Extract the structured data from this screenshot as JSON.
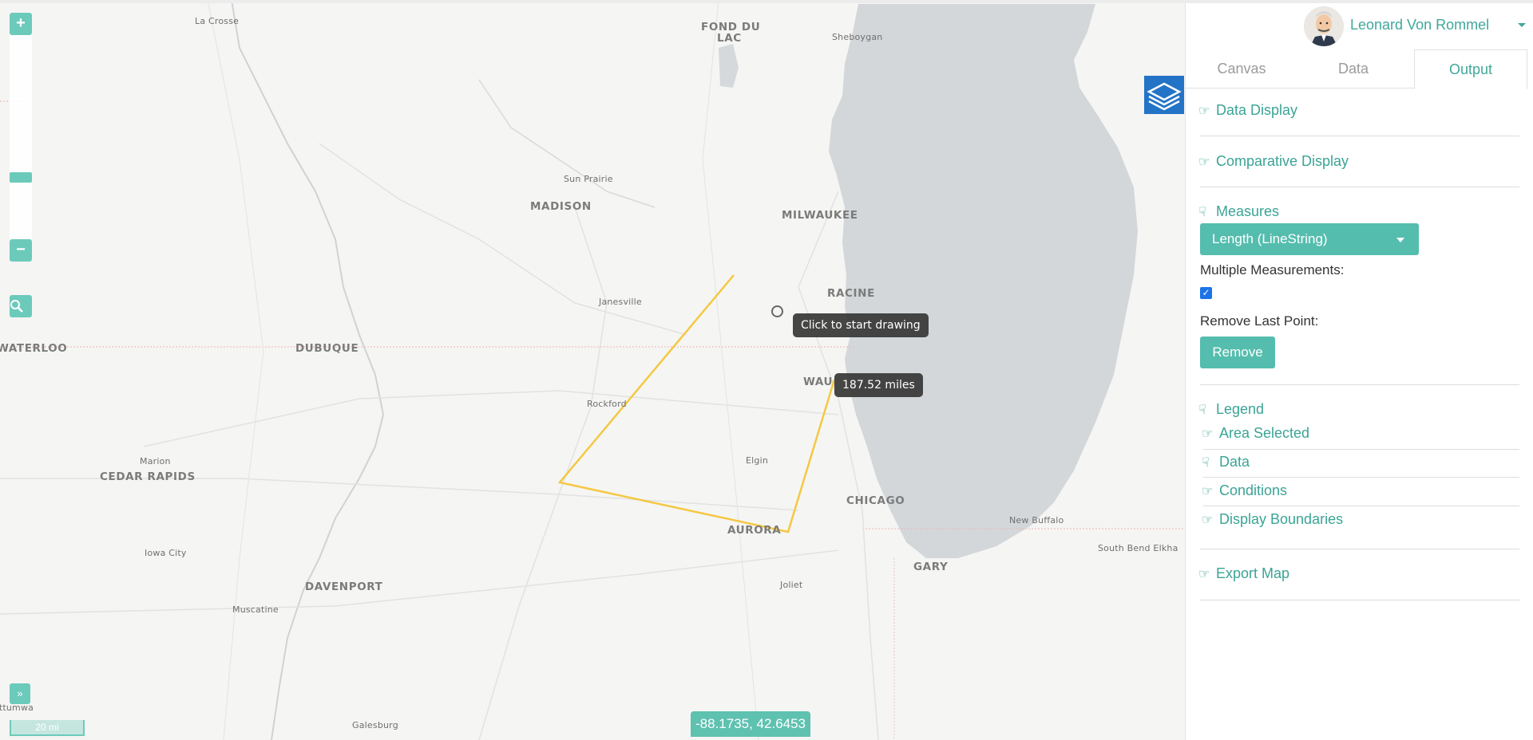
{
  "map": {
    "cities": [
      {
        "name": "La Crosse",
        "big": false
      },
      {
        "name": "FOND DU",
        "big": true
      },
      {
        "name": "LAC",
        "big": true
      },
      {
        "name": "Sheboygan",
        "big": false
      },
      {
        "name": "Sun Prairie",
        "big": false
      },
      {
        "name": "MADISON",
        "big": true
      },
      {
        "name": "MILWAUKEE",
        "big": true
      },
      {
        "name": "Janesville",
        "big": false
      },
      {
        "name": "RACINE",
        "big": true
      },
      {
        "name": "WATERLOO",
        "big": true
      },
      {
        "name": "DUBUQUE",
        "big": true
      },
      {
        "name": "WAU",
        "big": true
      },
      {
        "name": "Rockford",
        "big": false
      },
      {
        "name": "Marion",
        "big": false
      },
      {
        "name": "CEDAR RAPIDS",
        "big": true
      },
      {
        "name": "Elgin",
        "big": false
      },
      {
        "name": "CHICAGO",
        "big": true
      },
      {
        "name": "New Buffalo",
        "big": false
      },
      {
        "name": "AURORA",
        "big": true
      },
      {
        "name": "Iowa City",
        "big": false
      },
      {
        "name": "South Bend Elkha",
        "big": false
      },
      {
        "name": "GARY",
        "big": true
      },
      {
        "name": "DAVENPORT",
        "big": true
      },
      {
        "name": "Joliet",
        "big": false
      },
      {
        "name": "Muscatine",
        "big": false
      },
      {
        "name": "Galesburg",
        "big": false
      },
      {
        "name": "Ottumwa",
        "big": false
      }
    ],
    "tooltip_start": "Click to start drawing",
    "tooltip_measure": "187.52 miles",
    "coordinates": "-88.1735, 42.6453",
    "scale_label": "20 mi",
    "zoom_in": "+",
    "zoom_out": "−",
    "search_icon": "search-icon",
    "layers_icon": "layers-icon",
    "line_color": "#f5c842",
    "water_color": "#d3d7da"
  },
  "user": {
    "name": "Leonard Von Rommel"
  },
  "tabs": [
    {
      "label": "Canvas",
      "active": false
    },
    {
      "label": "Data",
      "active": false
    },
    {
      "label": "Output",
      "active": true
    }
  ],
  "panel": {
    "data_display": "Data Display",
    "comparative_display": "Comparative Display",
    "measures": "Measures",
    "measure_select": "Length (LineString)",
    "multiple_measurements": "Multiple Measurements:",
    "multiple_checked": true,
    "remove_last_point": "Remove Last Point:",
    "remove_button": "Remove",
    "legend": "Legend",
    "area_selected": "Area Selected",
    "data": "Data",
    "conditions": "Conditions",
    "display_boundaries": "Display Boundaries",
    "export_map": "Export Map"
  },
  "colors": {
    "accent": "#3aa495",
    "button": "#55bdae"
  }
}
